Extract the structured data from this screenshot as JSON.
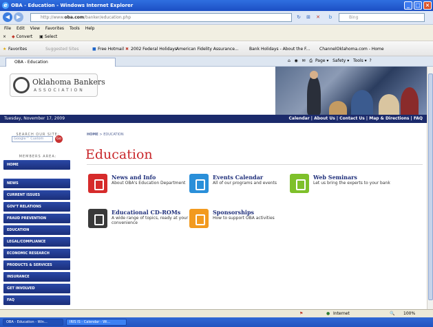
{
  "window": {
    "title": "OBA - Education - Windows Internet Explorer"
  },
  "address": {
    "url_prefix": "http://www.",
    "url_domain": "oba.com",
    "url_path": "/banker/education.php",
    "search_placeholder": "Bing"
  },
  "menu": [
    "File",
    "Edit",
    "View",
    "Favorites",
    "Tools",
    "Help"
  ],
  "links_bar": [
    "Convert",
    "Select"
  ],
  "favorites_bar": {
    "label": "Favorites",
    "items": [
      "Suggested Sites",
      "Free Hotmail",
      "2002 Federal Holidays",
      "American Fidelity Assurance...",
      "Bank Holidays - About the F...",
      "ChannelOklahoma.com - Home"
    ]
  },
  "tab": {
    "label": "OBA - Education",
    "tools": [
      "Page",
      "Safety",
      "Tools"
    ]
  },
  "site": {
    "logo_name": "Oklahoma Bankers",
    "logo_sub": "ASSOCIATION",
    "date": "Tuesday, November 17, 2009",
    "top_links": [
      "Calendar",
      "About Us",
      "Contact Us",
      "Map & Directions",
      "FAQ"
    ]
  },
  "sidebar": {
    "search_label": "SEARCH OUR SITE:",
    "search_placeholder": "Google™ Custom",
    "search_go": "Go",
    "members_label": "MEMBERS AREA:",
    "home": "HOME",
    "items": [
      "NEWS",
      "CURRENT ISSUES",
      "GOV'T RELATIONS",
      "FRAUD PREVENTION",
      "EDUCATION",
      "LEGAL/COMPLIANCE",
      "ECONOMIC RESEARCH",
      "PRODUCTS & SERVICES",
      "INSURANCE",
      "GET INVOLVED",
      "FAQ"
    ]
  },
  "content": {
    "crumb_home": "HOME",
    "crumb_current": "EDUCATION",
    "title": "Education",
    "cards": [
      {
        "title": "News and Info",
        "desc": "About OBA's Education Department",
        "color": "#d62b2b"
      },
      {
        "title": "Events Calendar",
        "desc": "All of our programs and events",
        "color": "#2a8fd9"
      },
      {
        "title": "Web Seminars",
        "desc": "Let us bring the experts to your bank",
        "color": "#7ec02a"
      },
      {
        "title": "Educational CD-ROMs",
        "desc": "A wide range of topics, ready at your convenience",
        "color": "#3a3a3a"
      },
      {
        "title": "Sponsorships",
        "desc": "How to support OBA activities",
        "color": "#f29a1f"
      }
    ]
  },
  "status": {
    "zone": "Internet",
    "zoom": "100%"
  },
  "taskbar": [
    "OBA - Education - Win...",
    "IRIS IS - Calendar - Wi..."
  ]
}
